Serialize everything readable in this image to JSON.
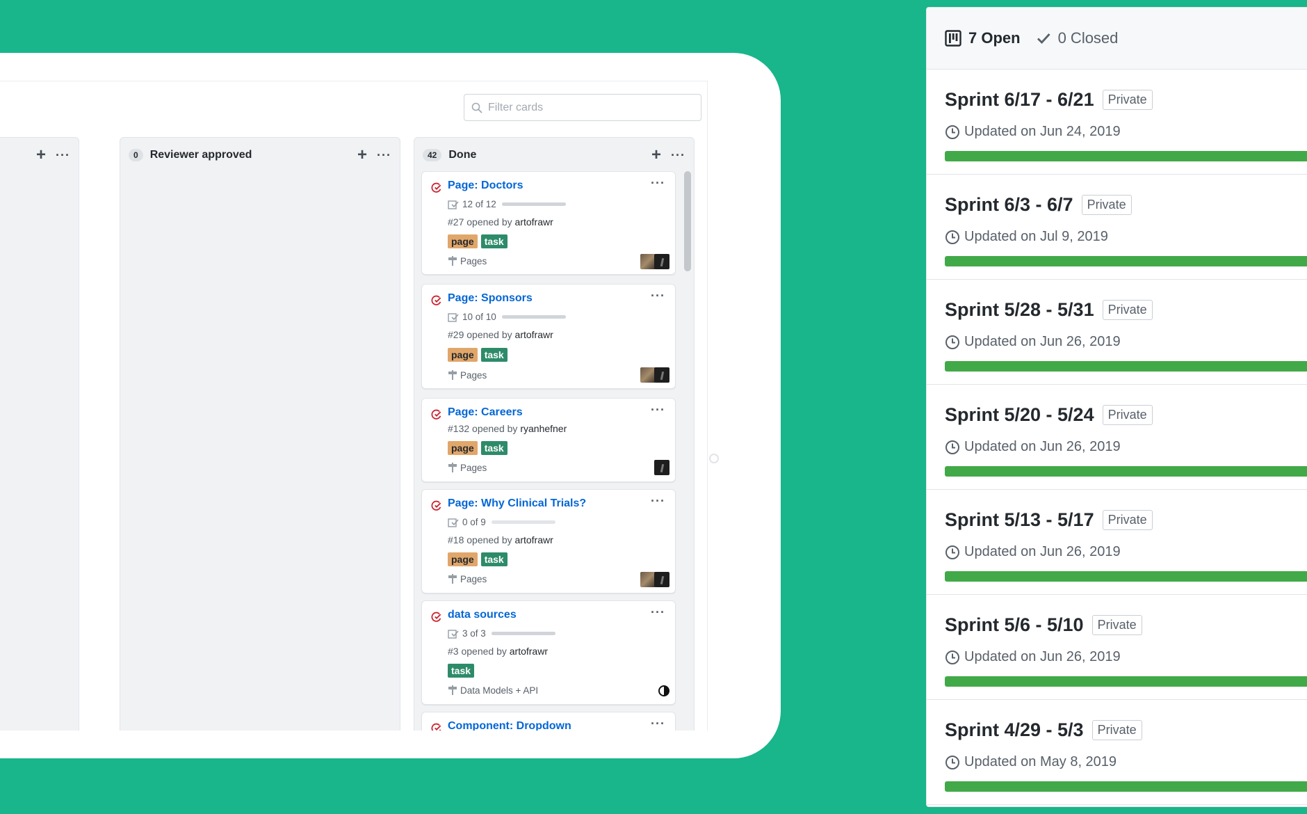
{
  "colors": {
    "background": "#19b58b",
    "link": "#0366d6",
    "label_page": "#e1a66a",
    "label_task": "#2e8b6a",
    "progress_green": "#42a948",
    "issue_icon": "#cb2431"
  },
  "board": {
    "filter_placeholder": "Filter cards",
    "columns": [
      {
        "count": "",
        "title": ""
      },
      {
        "count": "0",
        "title": "Reviewer approved"
      },
      {
        "count": "42",
        "title": "Done"
      }
    ],
    "cards": [
      {
        "title": "Page: Doctors",
        "progress_text": "12 of 12",
        "progress": 1.0,
        "issue": "#27 opened by ",
        "user": "artofrawr",
        "labels": [
          "page",
          "task"
        ],
        "milestone": "Pages"
      },
      {
        "title": "Page: Sponsors",
        "progress_text": "10 of 10",
        "progress": 1.0,
        "issue": "#29 opened by ",
        "user": "artofrawr",
        "labels": [
          "page",
          "task"
        ],
        "milestone": "Pages"
      },
      {
        "title": "Page: Careers",
        "issue": "#132 opened by ",
        "user": "ryanhefner",
        "labels": [
          "page",
          "task"
        ],
        "milestone": "Pages"
      },
      {
        "title": "Page: Why Clinical Trials?",
        "progress_text": "0 of 9",
        "progress": 0.0,
        "issue": "#18 opened by ",
        "user": "artofrawr",
        "labels": [
          "page",
          "task"
        ],
        "milestone": "Pages"
      },
      {
        "title": "data sources",
        "progress_text": "3 of 3",
        "progress": 1.0,
        "issue": "#3 opened by ",
        "user": "artofrawr",
        "labels": [
          "task"
        ],
        "milestone": "Data Models + API"
      },
      {
        "title": "Component: Dropdown"
      }
    ]
  },
  "panel": {
    "open_label": "7 Open",
    "closed_label": "0 Closed",
    "private_label": "Private",
    "sprints": [
      {
        "name": "Sprint 6/17 - 6/21",
        "updated": "Updated on Jun 24, 2019"
      },
      {
        "name": "Sprint 6/3 - 6/7",
        "updated": "Updated on Jul 9, 2019"
      },
      {
        "name": "Sprint 5/28 - 5/31",
        "updated": "Updated on Jun 26, 2019"
      },
      {
        "name": "Sprint 5/20 - 5/24",
        "updated": "Updated on Jun 26, 2019"
      },
      {
        "name": "Sprint 5/13 - 5/17",
        "updated": "Updated on Jun 26, 2019"
      },
      {
        "name": "Sprint 5/6 - 5/10",
        "updated": "Updated on Jun 26, 2019"
      },
      {
        "name": "Sprint 4/29 - 5/3",
        "updated": "Updated on May 8, 2019"
      }
    ]
  }
}
